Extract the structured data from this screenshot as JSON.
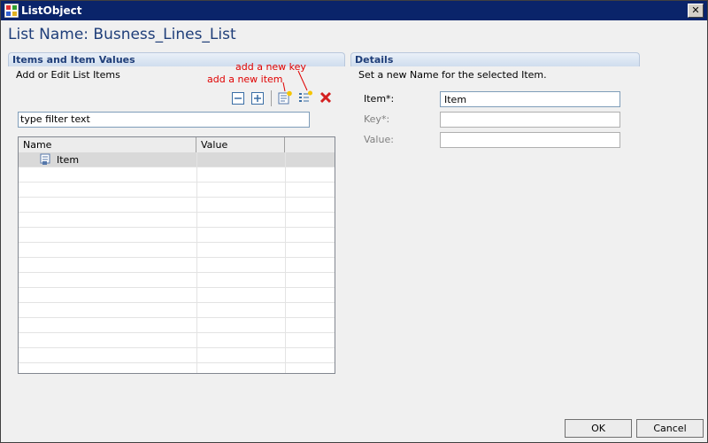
{
  "window": {
    "title": "ListObject",
    "close_glyph": "✕"
  },
  "header": {
    "list_name": "List Name: Busness_Lines_List"
  },
  "items_panel": {
    "title": "Items and Item Values",
    "subtitle": "Add or Edit List Items",
    "annotations": {
      "add_key": "add a new key",
      "add_item": "add a new item"
    },
    "toolbar": {
      "icons": [
        "collapse-all-icon",
        "expand-all-icon",
        "add-item-icon",
        "add-key-icon",
        "delete-icon"
      ]
    },
    "filter": {
      "value": "type filter text"
    },
    "table": {
      "columns": [
        "Name",
        "Value",
        ""
      ],
      "rows": [
        {
          "name": "Item",
          "value": ""
        }
      ]
    }
  },
  "details_panel": {
    "title": "Details",
    "subtitle": "Set a new Name for the selected Item.",
    "fields": [
      {
        "label": "Item*:",
        "value": "Item",
        "enabled": true
      },
      {
        "label": "Key*:",
        "value": "",
        "enabled": false
      },
      {
        "label": "Value:",
        "value": "",
        "enabled": false
      }
    ]
  },
  "footer": {
    "ok_label": "OK",
    "cancel_label": "Cancel"
  },
  "colors": {
    "title_bar": "#0a246a",
    "heading_text": "#1f3e79",
    "annotation": "#e00000",
    "delete_icon": "#d42020"
  }
}
